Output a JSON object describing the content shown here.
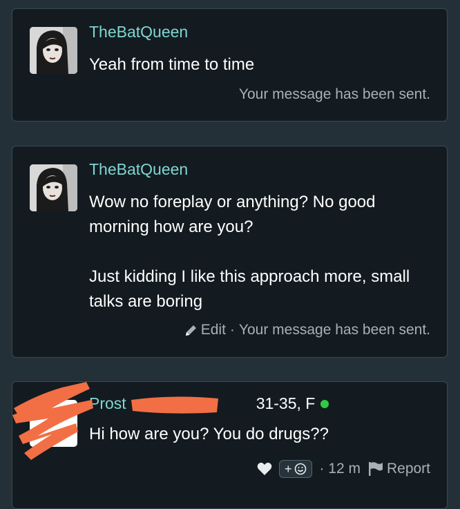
{
  "messages": [
    {
      "username": "TheBatQueen",
      "text": "Yeah from time to time",
      "status": "Your message has been sent."
    },
    {
      "username": "TheBatQueen",
      "text": "Wow no foreplay or anything? No good morning how are you?\n\nJust kidding I like this approach more, small talks are boring",
      "edit_label": "Edit",
      "separator": "·",
      "status": "Your message has been sent."
    },
    {
      "username_visible": "Prost",
      "age_sex": "31-35, F",
      "text": "Hi how are you? You do drugs??",
      "react_label": "+",
      "time": "· 12 m",
      "report_label": "Report"
    }
  ],
  "colors": {
    "background": "#233038",
    "card": "#131b20",
    "username": "#7fd6d2",
    "meta": "#a7b1b6",
    "online": "#2ecc40",
    "redaction": "#f26f45"
  },
  "icons": [
    "avatar-image",
    "pencil-icon",
    "heart-icon",
    "smiley-icon",
    "flag-icon",
    "online-indicator"
  ]
}
